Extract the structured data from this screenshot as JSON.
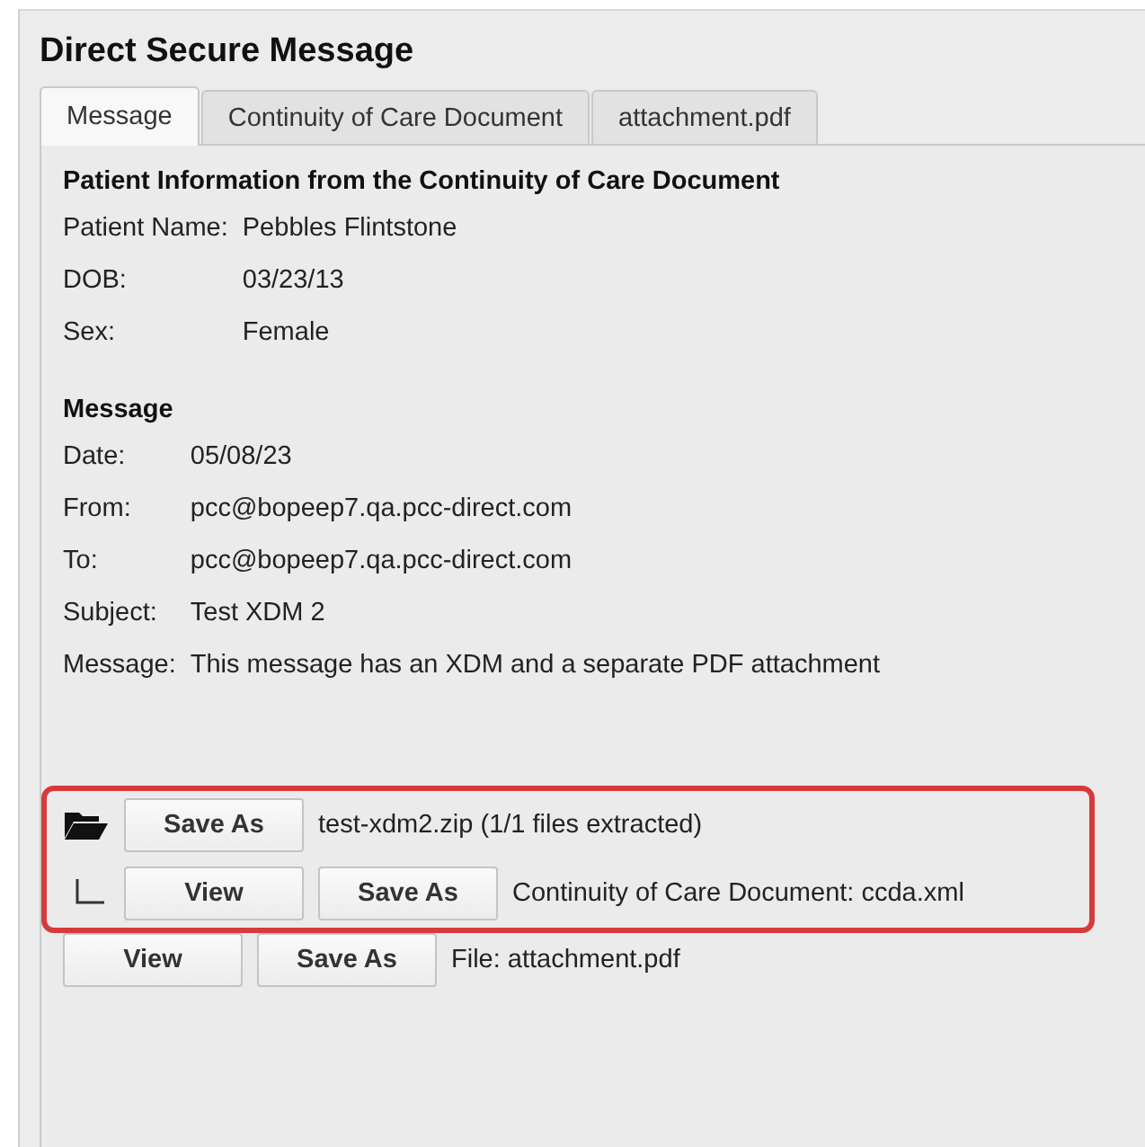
{
  "window": {
    "title": "Direct Secure Message"
  },
  "tabs": [
    {
      "label": "Message",
      "selected": true
    },
    {
      "label": "Continuity of Care Document",
      "selected": false
    },
    {
      "label": "attachment.pdf",
      "selected": false
    }
  ],
  "patient_info": {
    "heading": "Patient Information from the Continuity of Care Document",
    "fields": [
      {
        "label": "Patient Name:",
        "value": "Pebbles Flintstone"
      },
      {
        "label": "DOB:",
        "value": "03/23/13"
      },
      {
        "label": "Sex:",
        "value": "Female"
      }
    ]
  },
  "message": {
    "heading": "Message",
    "fields": [
      {
        "label": "Date:",
        "value": "05/08/23"
      },
      {
        "label": "From:",
        "value": "pcc@bopeep7.qa.pcc-direct.com"
      },
      {
        "label": "To:",
        "value": "pcc@bopeep7.qa.pcc-direct.com"
      },
      {
        "label": "Subject:",
        "value": "Test XDM 2"
      },
      {
        "label": "Message:",
        "value": "This message has an XDM and a separate PDF attachment"
      }
    ]
  },
  "attachments": [
    {
      "kind": "archive",
      "highlighted": true,
      "buttons": [
        "Save As"
      ],
      "text": "test-xdm2.zip (1/1 files extracted)"
    },
    {
      "kind": "child",
      "highlighted": true,
      "buttons": [
        "View",
        "Save As"
      ],
      "text": "Continuity of Care Document: ccda.xml"
    },
    {
      "kind": "file",
      "highlighted": false,
      "buttons": [
        "View",
        "Save As"
      ],
      "text": "File: attachment.pdf"
    }
  ]
}
